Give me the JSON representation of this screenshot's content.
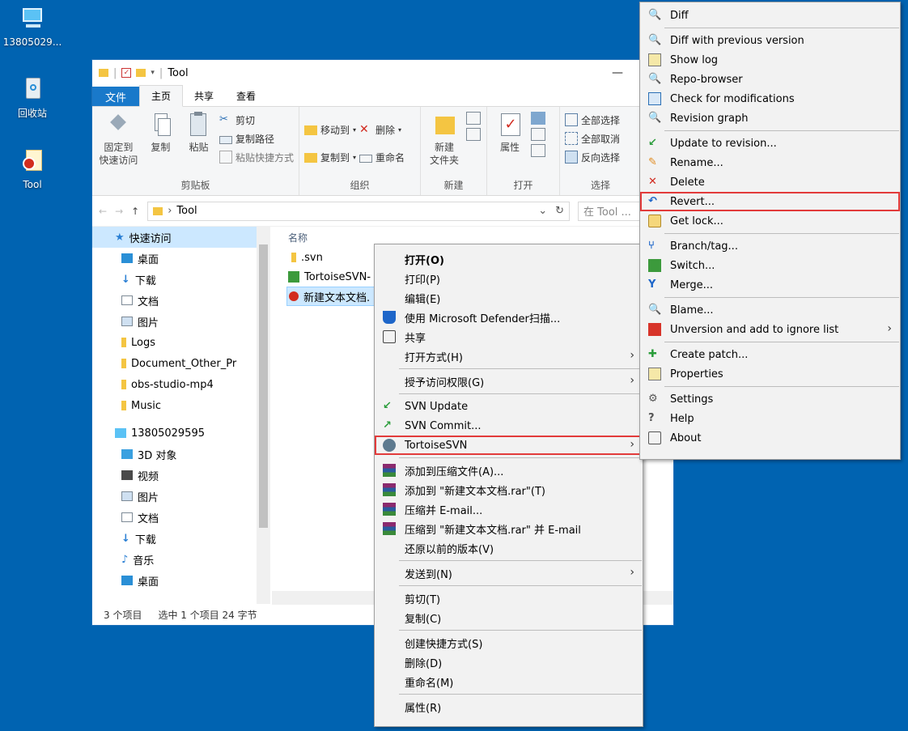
{
  "desktop": {
    "icons": [
      {
        "label": "13805029..."
      },
      {
        "label": "回收站"
      },
      {
        "label": "Tool"
      }
    ]
  },
  "explorer": {
    "title": "Tool",
    "window_controls": {
      "minimize": "—",
      "maximize": "☐"
    },
    "ribbon_tabs": [
      "文件",
      "主页",
      "共享",
      "查看"
    ],
    "ribbon": {
      "clipboard": {
        "group": "剪贴板",
        "pin": "固定到\n快速访问",
        "copy": "复制",
        "paste": "粘贴",
        "cut": "剪切",
        "copy_path": "复制路径",
        "paste_shortcut": "粘贴快捷方式"
      },
      "organize": {
        "group": "组织",
        "move_to": "移动到",
        "copy_to": "复制到",
        "delete": "删除",
        "rename": "重命名"
      },
      "new": {
        "group": "新建",
        "new_folder": "新建\n文件夹"
      },
      "open": {
        "group": "打开",
        "properties": "属性"
      },
      "select": {
        "group": "选择",
        "select_all": "全部选择",
        "select_none": "全部取消",
        "invert": "反向选择"
      }
    },
    "address": {
      "path": "Tool",
      "search_placeholder": "在 Tool ..."
    },
    "nav": {
      "quick_access": "快速访问",
      "quick_items": [
        "桌面",
        "下载",
        "文档",
        "图片",
        "Logs",
        "Document_Other_Pr",
        "obs-studio-mp4",
        "Music"
      ],
      "pc": "13805029595",
      "pc_items": [
        "3D 对象",
        "视频",
        "图片",
        "文档",
        "下载",
        "音乐",
        "桌面"
      ]
    },
    "files": {
      "column_name": "名称",
      "items": [
        ".svn",
        "TortoiseSVN-",
        "新建文本文档."
      ]
    },
    "status": {
      "count": "3 个项目",
      "selected": "选中 1 个项目  24 字节"
    }
  },
  "context_menu": {
    "items": [
      {
        "label": "打开(O)",
        "bold": true
      },
      {
        "label": "打印(P)"
      },
      {
        "label": "编辑(E)"
      },
      {
        "label": "使用 Microsoft Defender扫描...",
        "icon": "defender-icon"
      },
      {
        "label": "共享",
        "icon": "share-icon"
      },
      {
        "label": "打开方式(H)",
        "submenu": true
      },
      {
        "label": "授予访问权限(G)",
        "submenu": true
      },
      {
        "label": "SVN Update",
        "icon": "svn-update-icon"
      },
      {
        "label": "SVN Commit...",
        "icon": "svn-commit-icon"
      },
      {
        "label": "TortoiseSVN",
        "icon": "tortoise-icon",
        "submenu": true,
        "highlight": true
      },
      {
        "label": "添加到压缩文件(A)...",
        "icon": "winrar-icon"
      },
      {
        "label": "添加到 \"新建文本文档.rar\"(T)",
        "icon": "winrar-icon"
      },
      {
        "label": "压缩并 E-mail...",
        "icon": "winrar-icon"
      },
      {
        "label": "压缩到 \"新建文本文档.rar\" 并 E-mail",
        "icon": "winrar-icon"
      },
      {
        "label": "还原以前的版本(V)"
      },
      {
        "label": "发送到(N)",
        "submenu": true
      },
      {
        "label": "剪切(T)"
      },
      {
        "label": "复制(C)"
      },
      {
        "label": "创建快捷方式(S)"
      },
      {
        "label": "删除(D)"
      },
      {
        "label": "重命名(M)"
      },
      {
        "label": "属性(R)"
      }
    ]
  },
  "svn_menu": {
    "items": [
      {
        "label": "Diff",
        "icon": "diff-icon"
      },
      {
        "label": "Diff with previous version",
        "icon": "diff-icon"
      },
      {
        "label": "Show log",
        "icon": "log-icon"
      },
      {
        "label": "Repo-browser",
        "icon": "repo-browser-icon"
      },
      {
        "label": "Check for modifications",
        "icon": "check-modifications-icon"
      },
      {
        "label": "Revision graph",
        "icon": "revision-graph-icon"
      },
      {
        "label": "Update to revision...",
        "icon": "update-icon"
      },
      {
        "label": "Rename...",
        "icon": "rename-icon"
      },
      {
        "label": "Delete",
        "icon": "delete-icon"
      },
      {
        "label": "Revert...",
        "icon": "revert-icon",
        "highlight": true
      },
      {
        "label": "Get lock...",
        "icon": "lock-icon"
      },
      {
        "label": "Branch/tag...",
        "icon": "branch-icon"
      },
      {
        "label": "Switch...",
        "icon": "switch-icon"
      },
      {
        "label": "Merge...",
        "icon": "merge-icon"
      },
      {
        "label": "Blame...",
        "icon": "blame-icon"
      },
      {
        "label": "Unversion and add to ignore list",
        "icon": "ignore-icon",
        "submenu": true
      },
      {
        "label": "Create patch...",
        "icon": "patch-icon"
      },
      {
        "label": "Properties",
        "icon": "properties-icon"
      },
      {
        "label": "Settings",
        "icon": "settings-icon"
      },
      {
        "label": "Help",
        "icon": "help-icon"
      },
      {
        "label": "About",
        "icon": "about-icon"
      }
    ]
  },
  "colors": {
    "desktop": "#0063b1",
    "highlight_border": "#e23b3b",
    "file_tab": "#1979ca"
  }
}
